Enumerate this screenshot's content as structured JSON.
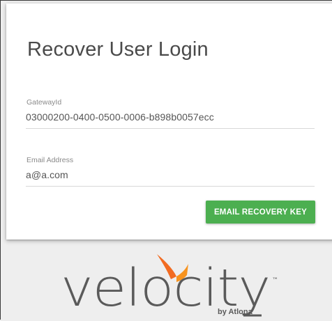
{
  "page": {
    "title": "Recover User Login"
  },
  "form": {
    "gateway": {
      "label": "GatewayId",
      "value": "03000200-0400-0500-0006-b898b0057ecc"
    },
    "email": {
      "label": "Email Address",
      "value": "a@a.com"
    },
    "submit_label": "EMAIL RECOVERY KEY"
  },
  "branding": {
    "logo_text": "velocity",
    "trademark": "™",
    "byline": "by Atlona",
    "accent_color": "#f26b21",
    "text_color": "#5a5a5a"
  },
  "colors": {
    "button": "#4caf50",
    "background": "#eeeeee"
  }
}
